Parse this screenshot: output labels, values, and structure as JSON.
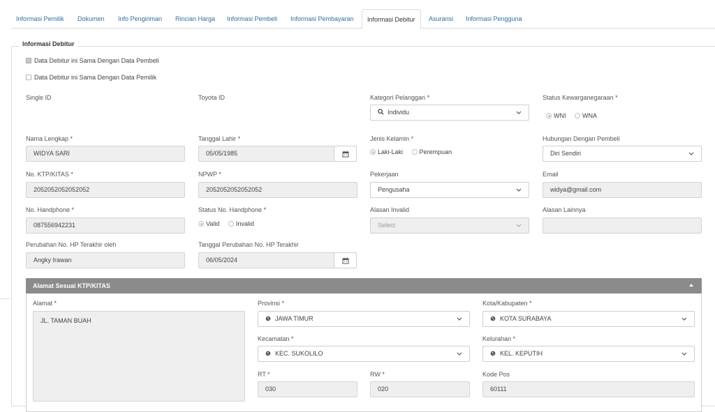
{
  "tabs": [
    {
      "label": "Informasi Pemilik"
    },
    {
      "label": "Dokumen"
    },
    {
      "label": "Info Pengiriman"
    },
    {
      "label": "Rincian Harga"
    },
    {
      "label": "Informasi Pembeli"
    },
    {
      "label": "Informasi Pembayaran"
    },
    {
      "label": "Informasi Debitur"
    },
    {
      "label": "Asuransi"
    },
    {
      "label": "Informasi Pengguna"
    }
  ],
  "active_tab": "Informasi Debitur",
  "section_title": "Informasi Debitur",
  "checks": {
    "same_as_buyer": "Data Debitur ini Sama Dengan Data Pembeli",
    "same_as_owner": "Data Debitur ini Sama Dengan Data Pemilik"
  },
  "labels": {
    "single_id": "Single ID",
    "toyota_id": "Toyota ID",
    "kategori": "Kategori Pelanggan *",
    "kewarganegaraan": "Status Kewarganegaraan *",
    "nama": "Nama Lengkap *",
    "tgl_lahir": "Tanggal Lahir *",
    "jenis_kelamin": "Jenis Kelamin *",
    "hubungan": "Hubungan Dengan Pembeli",
    "ktp": "No. KTP/KITAS *",
    "npwp": "NPWP *",
    "pekerjaan": "Pekerjaan",
    "email": "Email",
    "handphone": "No. Handphone *",
    "status_hp": "Status No. Handphone *",
    "alasan_invalid": "Alasan Invalid",
    "alasan_lain": "Alasan Lainnya",
    "perubahan_oleh": "Perubahan No. HP Terakhir oleh",
    "tgl_perubahan": "Tanggal Perubahan No. HP Terakhir"
  },
  "values": {
    "kategori": "Individu",
    "wni": "WNI",
    "wna": "WNA",
    "nama": "WIDYA SARI",
    "tgl_lahir": "05/05/1985",
    "laki": "Laki-Laki",
    "perempuan": "Perempuan",
    "hubungan": "Diri Sendiri",
    "ktp": "2052052052052052",
    "npwp": "2052052052052052",
    "pekerjaan": "Pengusaha",
    "email": "widya@gmail.com",
    "handphone": "087556942231",
    "valid": "Valid",
    "invalid": "Invalid",
    "alasan_invalid_placeholder": "Select",
    "perubahan_oleh": "Angky Irawan",
    "tgl_perubahan": "06/05/2024"
  },
  "alamat_panel": {
    "title": "Alamat Sesuai KTP/KITAS",
    "labels": {
      "alamat": "Alamat *",
      "provinsi": "Provinsi *",
      "kota": "Kota/Kabupaten *",
      "kecamatan": "Kecamatan *",
      "kelurahan": "Kelurahan *",
      "rt": "RT *",
      "rw": "RW *",
      "kode_pos": "Kode Pos"
    },
    "values": {
      "alamat": "JL. TAMAN BUAH",
      "provinsi": "JAWA TIMUR",
      "kota": "KOTA SURABAYA",
      "kecamatan": "KEC. SUKOLILO",
      "kelurahan": "KEL. KEPUTIH",
      "rt": "030",
      "rw": "020",
      "kode_pos": "60111"
    }
  },
  "colors": {
    "tab_link": "#2c6fa8",
    "panel_header": "#8b8b8b",
    "readonly_bg": "#efefef"
  }
}
